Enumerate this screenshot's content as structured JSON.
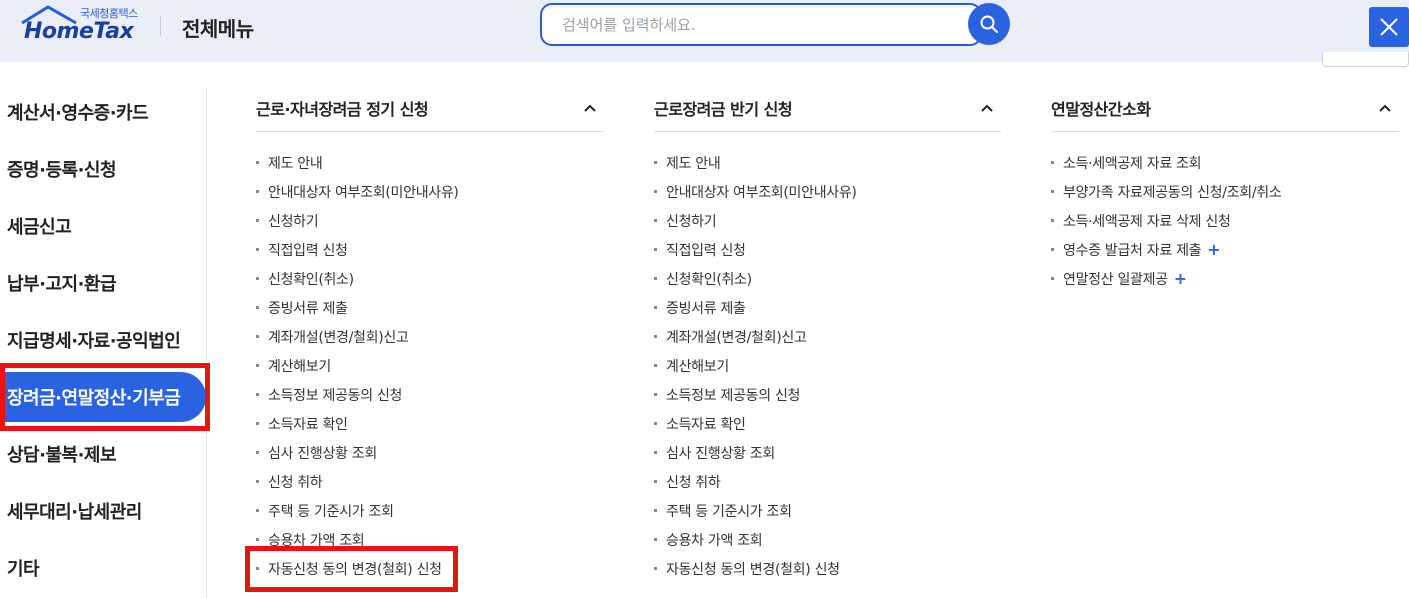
{
  "header": {
    "logo_small": "국세청홈택스",
    "logo_main": "HomeTax",
    "menu_title": "전체메뉴",
    "search_placeholder": "검색어를 입력하세요.",
    "search_icon": "search-icon",
    "close_icon": "close-icon"
  },
  "left_nav": {
    "active_index": 5,
    "items": [
      {
        "label": "계산서·영수증·카드"
      },
      {
        "label": "증명·등록·신청"
      },
      {
        "label": "세금신고"
      },
      {
        "label": "납부·고지·환급"
      },
      {
        "label": "지급명세·자료·공익법인"
      },
      {
        "label": "장려금·연말정산·기부금"
      },
      {
        "label": "상담·불복·제보"
      },
      {
        "label": "세무대리·납세관리"
      },
      {
        "label": "기타"
      }
    ]
  },
  "columns": [
    {
      "title": "근로·자녀장려금 정기 신청",
      "items": [
        {
          "label": "제도 안내"
        },
        {
          "label": "안내대상자 여부조회(미안내사유)"
        },
        {
          "label": "신청하기"
        },
        {
          "label": "직접입력 신청"
        },
        {
          "label": "신청확인(취소)"
        },
        {
          "label": "증빙서류 제출"
        },
        {
          "label": "계좌개설(변경/철회)신고"
        },
        {
          "label": "계산해보기"
        },
        {
          "label": "소득정보 제공동의 신청"
        },
        {
          "label": "소득자료 확인"
        },
        {
          "label": "심사 진행상황 조회"
        },
        {
          "label": "신청 취하"
        },
        {
          "label": "주택 등 기준시가 조회"
        },
        {
          "label": "승용차 가액 조회"
        },
        {
          "label": "자동신청 동의 변경(철회) 신청"
        }
      ]
    },
    {
      "title": "근로장려금 반기 신청",
      "items": [
        {
          "label": "제도 안내"
        },
        {
          "label": "안내대상자 여부조회(미안내사유)"
        },
        {
          "label": "신청하기"
        },
        {
          "label": "직접입력 신청"
        },
        {
          "label": "신청확인(취소)"
        },
        {
          "label": "증빙서류 제출"
        },
        {
          "label": "계좌개설(변경/철회)신고"
        },
        {
          "label": "계산해보기"
        },
        {
          "label": "소득정보 제공동의 신청"
        },
        {
          "label": "소득자료 확인"
        },
        {
          "label": "심사 진행상황 조회"
        },
        {
          "label": "신청 취하"
        },
        {
          "label": "주택 등 기준시가 조회"
        },
        {
          "label": "승용차 가액 조회"
        },
        {
          "label": "자동신청 동의 변경(철회) 신청"
        }
      ]
    },
    {
      "title": "연말정산간소화",
      "items": [
        {
          "label": "소득·세액공제 자료 조회"
        },
        {
          "label": "부양가족 자료제공동의 신청/조회/취소"
        },
        {
          "label": "소득·세액공제 자료 삭제 신청"
        },
        {
          "label": "영수증 발급처 자료 제출",
          "plus": "+"
        },
        {
          "label": "연말정산 일괄제공",
          "plus": "+"
        }
      ]
    }
  ],
  "colors": {
    "accent": "#2a63e0",
    "highlight_box": "#ee1111",
    "header_bg": "#e9eef7"
  }
}
